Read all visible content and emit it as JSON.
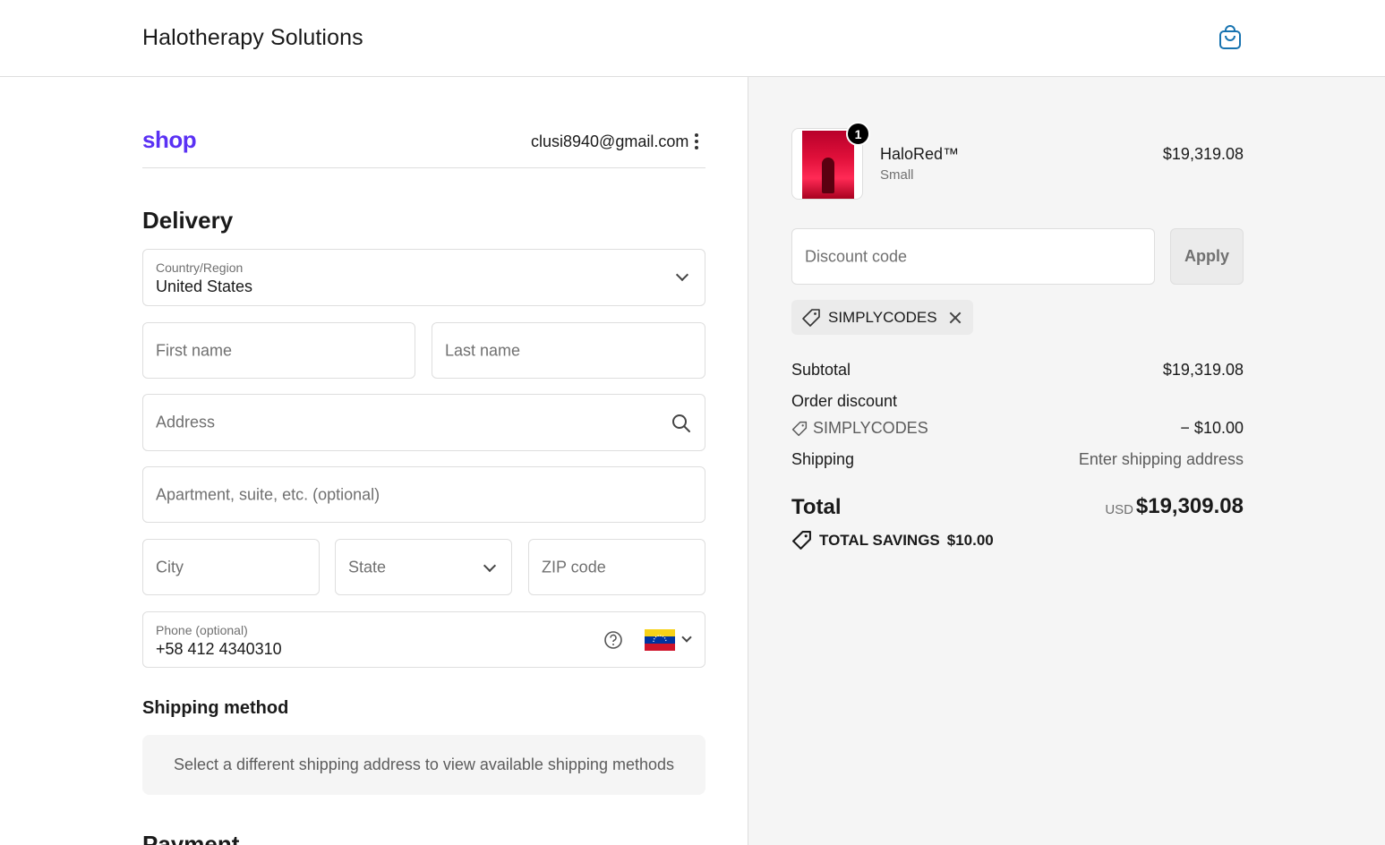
{
  "header": {
    "store_name": "Halotherapy Solutions",
    "cart_icon": "shopping-bag-icon"
  },
  "account": {
    "logo": "shop",
    "email": "clusi8940@gmail.com"
  },
  "delivery": {
    "heading": "Delivery",
    "country": {
      "label": "Country/Region",
      "value": "United States"
    },
    "first_name": {
      "placeholder": "First name"
    },
    "last_name": {
      "placeholder": "Last name"
    },
    "address": {
      "placeholder": "Address"
    },
    "apartment": {
      "placeholder": "Apartment, suite, etc. (optional)"
    },
    "city": {
      "placeholder": "City"
    },
    "state": {
      "placeholder": "State"
    },
    "zip": {
      "placeholder": "ZIP code"
    },
    "phone": {
      "label": "Phone (optional)",
      "value": "+58 412 4340310",
      "flag": "venezuela-flag"
    }
  },
  "shipping": {
    "heading": "Shipping method",
    "note": "Select a different shipping address to view available shipping methods"
  },
  "payment": {
    "heading": "Payment"
  },
  "order": {
    "item": {
      "name": "HaloRed™",
      "variant": "Small",
      "price": "$19,319.08",
      "quantity": "1"
    },
    "discount": {
      "placeholder": "Discount code",
      "apply_label": "Apply",
      "applied_code": "SIMPLYCODES"
    },
    "summary": {
      "subtotal_label": "Subtotal",
      "subtotal_value": "$19,319.08",
      "order_discount_label": "Order discount",
      "discount_code": "SIMPLYCODES",
      "discount_value": "− $10.00",
      "shipping_label": "Shipping",
      "shipping_value": "Enter shipping address",
      "total_label": "Total",
      "currency": "USD",
      "total_value": "$19,309.08",
      "savings_label": "TOTAL SAVINGS",
      "savings_value": "$10.00"
    }
  }
}
